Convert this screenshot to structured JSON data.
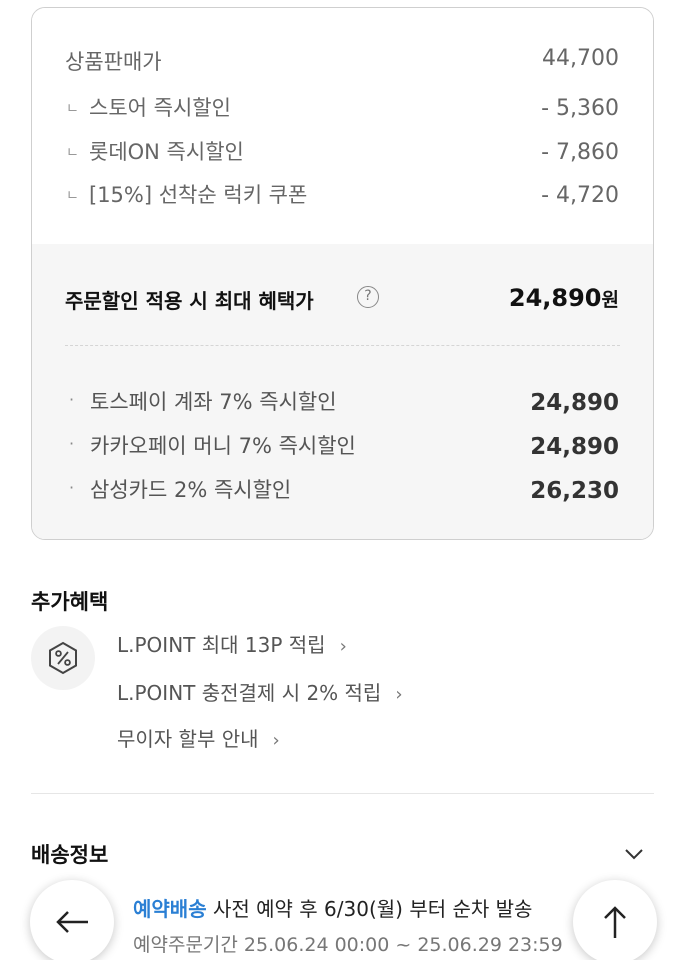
{
  "price_summary": {
    "sale_price": {
      "label": "상품판매가",
      "value": "44,700"
    },
    "discounts": [
      {
        "prefix": "ㄴ",
        "label": "스토어 즉시할인",
        "value": "- 5,360"
      },
      {
        "prefix": "ㄴ",
        "label": "롯데ON 즉시할인",
        "value": "- 7,860"
      },
      {
        "prefix": "ㄴ",
        "label": "[15%] 선착순 럭키 쿠폰",
        "value": "- 4,720"
      }
    ],
    "max_benefit": {
      "label": "주문할인 적용 시 최대 혜택가",
      "help_icon": "?",
      "value": "24,890",
      "unit": "원"
    },
    "payment_options": [
      {
        "label": "토스페이 계좌 7% 즉시할인",
        "value": "24,890"
      },
      {
        "label": "카카오페이 머니 7% 즉시할인",
        "value": "24,890"
      },
      {
        "label": "삼성카드 2% 즉시할인",
        "value": "26,230"
      }
    ]
  },
  "extra_benefits": {
    "title": "추가혜택",
    "icon": "percent-badge-icon",
    "links": [
      {
        "label": "L.POINT 최대 13P 적립",
        "chevron": "›"
      },
      {
        "label": "L.POINT 충전결제 시 2% 적립",
        "chevron": "›"
      },
      {
        "label": "무이자 할부 안내",
        "chevron": "›"
      }
    ]
  },
  "shipping": {
    "title": "배송정보",
    "highlight": "예약배송",
    "text": " 사전 예약 후 6/30(월) 부터 순차 발송",
    "period": "예약주문기간 25.06.24 00:00 ~ 25.06.29 23:59"
  },
  "nav": {
    "back_icon": "arrow-left-icon",
    "top_icon": "arrow-up-icon"
  },
  "colors": {
    "accent": "#2a7fd4",
    "card_border": "#cfcfcf",
    "card_gray": "#f6f6f6"
  }
}
